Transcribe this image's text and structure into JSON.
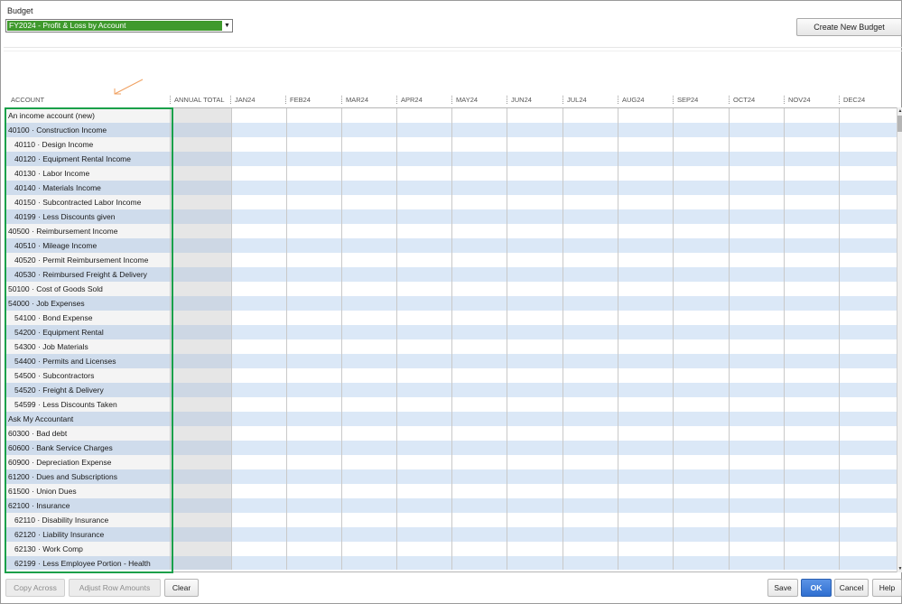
{
  "budget": {
    "label": "Budget",
    "selected": "FY2024 - Profit & Loss by Account"
  },
  "toolbar": {
    "create_new_budget": "Create New Budget"
  },
  "columns": {
    "account": "ACCOUNT",
    "annual_total": "ANNUAL TOTAL",
    "months": [
      "JAN24",
      "FEB24",
      "MAR24",
      "APR24",
      "MAY24",
      "JUN24",
      "JUL24",
      "AUG24",
      "SEP24",
      "OCT24",
      "NOV24",
      "DEC24"
    ]
  },
  "rows": [
    "An income account (new)",
    "40100 · Construction Income",
    "40110 · Design Income",
    "40120 · Equipment Rental Income",
    "40130 · Labor Income",
    "40140 · Materials Income",
    "40150 · Subcontracted Labor Income",
    "40199 · Less Discounts given",
    "40500 · Reimbursement Income",
    "40510 · Mileage Income",
    "40520 · Permit Reimbursement Income",
    "40530 · Reimbursed Freight & Delivery",
    "50100 · Cost of Goods Sold",
    "54000 · Job Expenses",
    "54100 · Bond Expense",
    "54200 · Equipment Rental",
    "54300 · Job Materials",
    "54400 · Permits and Licenses",
    "54500 · Subcontractors",
    "54520 · Freight & Delivery",
    "54599 · Less Discounts Taken",
    "Ask My Accountant",
    "60300 · Bad debt",
    "60600 · Bank Service Charges",
    "60900 · Depreciation Expense",
    "61200 · Dues and Subscriptions",
    "61500 · Union Dues",
    "62100 · Insurance",
    "62110 · Disability Insurance",
    "62120 · Liability Insurance",
    "62130 · Work Comp",
    "62199 · Less Employee Portion - Health"
  ],
  "buttons": {
    "copy_across": "Copy Across",
    "adjust_row_amounts": "Adjust Row Amounts",
    "clear": "Clear",
    "save": "Save",
    "ok": "OK",
    "cancel": "Cancel",
    "help": "Help"
  },
  "colors": {
    "selected_budget_bg": "#3f9a2d",
    "highlight_box": "#1aa04a",
    "annotation_arrow": "#f0a060",
    "row_stripe": "#dbe8f7",
    "ok_button": "#2f6fd0"
  },
  "icons": {
    "dropdown": "chevron-down-icon",
    "annotation": "arrow-annotation-icon",
    "scroll_up": "scroll-up-icon",
    "scroll_down": "scroll-down-icon"
  }
}
